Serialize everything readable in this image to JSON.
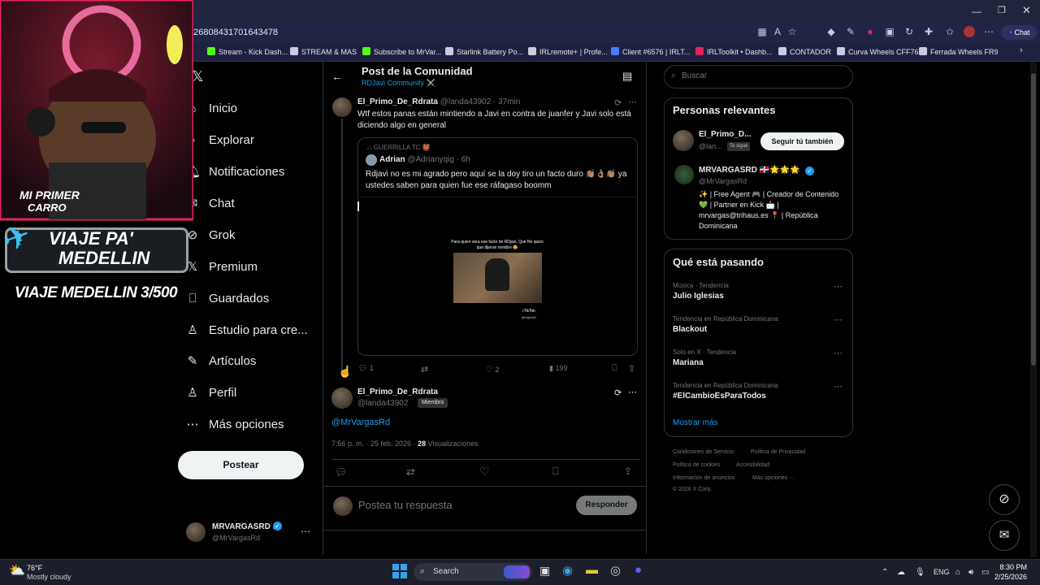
{
  "browser": {
    "url": "026808431701643478",
    "chat_label": "Chat",
    "bookmarks": [
      {
        "label": "Stream - Kick Dash...",
        "color": "#53fc18"
      },
      {
        "label": "STREAM & MAS",
        "color": "#c9cbe0"
      },
      {
        "label": "Subscribe to MrVar...",
        "color": "#53fc18"
      },
      {
        "label": "Starlink Battery Po...",
        "color": "#c9cbe0"
      },
      {
        "label": "IRLremote+ | Profe...",
        "color": "#c9cbe0"
      },
      {
        "label": "Client #6576 | IRLT...",
        "color": "#4a7bff"
      },
      {
        "label": "IRLToolkit • Dashb...",
        "color": "#e0245e"
      },
      {
        "label": "CONTADOR",
        "color": "#c9cbe0"
      },
      {
        "label": "Curva Wheels CFF76",
        "color": "#c9cbe0"
      },
      {
        "label": "Ferrada Wheels FR9",
        "color": "#c9cbe0"
      }
    ]
  },
  "overlay": {
    "banner_top": "MI PRIMER",
    "banner_top2": "CARRO",
    "sign_line1": "VIAJE PA'",
    "sign_line2": "MEDELLIN",
    "counter_text": "VIAJE MEDELLIN 3/500"
  },
  "nav": {
    "items": [
      {
        "label": "Inicio",
        "icon": "home-icon"
      },
      {
        "label": "Explorar",
        "icon": "search-icon"
      },
      {
        "label": "Notificaciones",
        "icon": "bell-icon"
      },
      {
        "label": "Chat",
        "icon": "chat-icon"
      },
      {
        "label": "Grok",
        "icon": "grok-icon"
      },
      {
        "label": "Premium",
        "icon": "x-icon"
      },
      {
        "label": "Guardados",
        "icon": "bookmark-icon"
      },
      {
        "label": "Estudio para cre...",
        "icon": "studio-icon"
      },
      {
        "label": "Artículos",
        "icon": "articles-icon"
      },
      {
        "label": "Perfil",
        "icon": "person-icon"
      },
      {
        "label": "Más opciones",
        "icon": "more-circle-icon"
      }
    ],
    "post_button": "Postear",
    "account_name": "MRVARGASRD ...",
    "account_handle": "@MrVargasRd"
  },
  "header": {
    "title": "Post de la Comunidad",
    "community": "RDJavi Community ⚔️"
  },
  "reply_post": {
    "name": "El_Primo_De_Rdrata",
    "handle": "@landa43902",
    "time": "· 37min",
    "text": "Wtf estos panas están mintiendo a Javi en contra de juanfer y Javi solo está diciendo algo en general",
    "quote": {
      "community": "GUERRILLA TC 👹",
      "name": "Adrian",
      "handle": "@Adrianyqig",
      "time": "· 6h",
      "text": "Rdjavi no es mi agrado pero aquí se la doy tiro un facto duro 👏🏽👌🏽👏🏽 ya ustedes saben para quien fue ese ráfagaso boomm",
      "video_caption": "Para quien sera ese facto de RDjavi, Que No quizo que dijeran nombre 😂",
      "video_brand": "TikTok",
      "video_user": "@rdjavi01"
    },
    "stats": {
      "replies": "1",
      "reposts": "",
      "likes": "2",
      "views": "199"
    }
  },
  "main_post": {
    "name": "El_Primo_De_Rdrata",
    "handle": "@landa43902",
    "badge": "Miembro",
    "mention": "@MrVargasRd",
    "timestamp": "7:56 p. m. · 25 feb. 2026 ·",
    "views_count": "28",
    "views_label": "Visualizaciones",
    "reply_placeholder": "Postea tu respuesta",
    "reply_button": "Responder"
  },
  "sidebar": {
    "search_placeholder": "Buscar",
    "relevant_title": "Personas relevantes",
    "people": [
      {
        "name": "El_Primo_D...",
        "handle": "@lan...",
        "tag": "Te sigue",
        "button": "Seguir tú también"
      },
      {
        "name": "MRVARGASRD 🇩🇴🌟🌟🌟",
        "handle": "@MrVargasRd",
        "bio": "✨ | Free Agent 🎮 | Creador de Contenido 💚 | Partner en Kick 📩 | mrvargas@trihaus.es 📍 | República Dominicana"
      }
    ],
    "trends_title": "Qué está pasando",
    "trends": [
      {
        "meta": "Música · Tendencia",
        "name": "Julio Iglesias"
      },
      {
        "meta": "Tendencia en República Dominicana",
        "name": "Blackout"
      },
      {
        "meta": "Solo en X · Tendencia",
        "name": "Mariana"
      },
      {
        "meta": "Tendencia en República Dominicana",
        "name": "#ElCambioEsParaTodos"
      }
    ],
    "show_more": "Mostrar más",
    "footer": [
      "Condiciones de Servicio",
      "Política de Privacidad",
      "Política de cookies",
      "Accesibilidad",
      "Información de anuncios",
      "Más opciones ···",
      "© 2026 X Corp."
    ]
  },
  "taskbar": {
    "weather_temp": "76°F",
    "weather_desc": "Mostly cloudy",
    "search_label": "Search",
    "language": "ENG",
    "time": "8:30 PM",
    "date": "2/25/2026"
  }
}
